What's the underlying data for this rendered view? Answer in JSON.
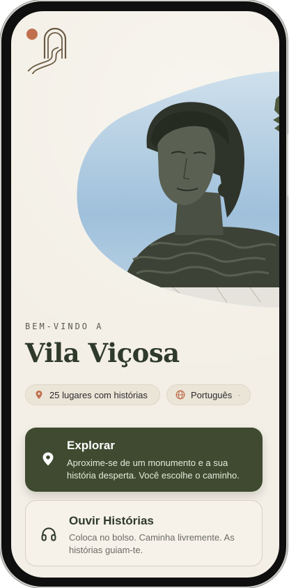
{
  "welcome": {
    "overline": "BEM-VINDO A",
    "title": "Vila Viçosa"
  },
  "chips": {
    "places": "25 lugares com histórias",
    "language": "Português",
    "language_dot": "·"
  },
  "actions": [
    {
      "title": "Explorar",
      "description": "Aproxime-se de um monumento e a sua história desperta. Você escolhe o caminho."
    },
    {
      "title": "Ouvir Histórias",
      "description": "Coloca no bolso. Caminha livremente. As histórias guiam-te."
    }
  ],
  "icons": {
    "logo": "arch-road-logo",
    "pin": "map-pin-icon",
    "globe": "globe-icon",
    "explore": "location-pin-icon",
    "listen": "headphones-icon"
  },
  "colors": {
    "background": "#f3efe6",
    "primary_card": "#3f4a30",
    "accent": "#c0704e",
    "title": "#2f3a2a"
  }
}
